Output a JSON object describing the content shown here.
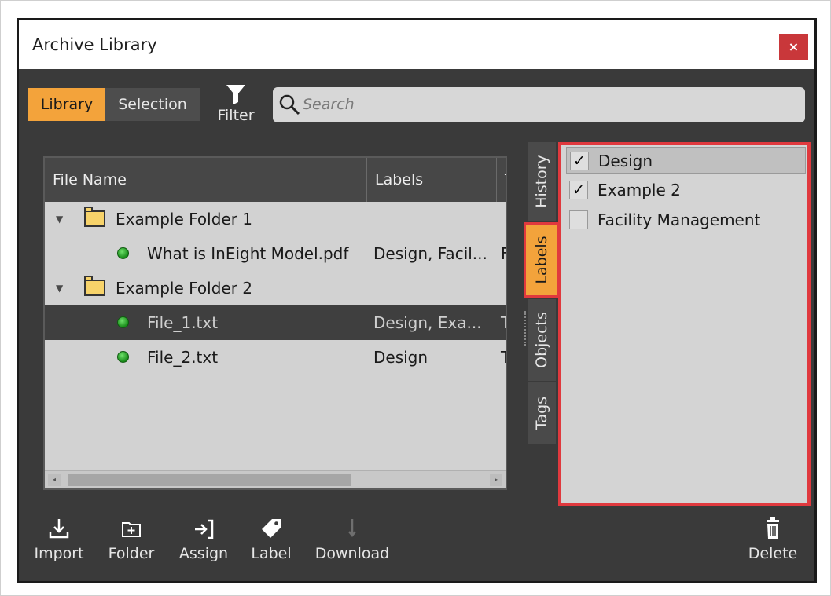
{
  "window": {
    "title": "Archive Library",
    "close_label": "×"
  },
  "top": {
    "tabs": [
      "Library",
      "Selection"
    ],
    "filter_label": "Filter",
    "search_placeholder": "Search"
  },
  "tree": {
    "columns": [
      "File Name",
      "Labels",
      "T"
    ],
    "rows": [
      {
        "type": "folder",
        "name": "Example Folder 1",
        "labels": "",
        "extra": ""
      },
      {
        "type": "file",
        "name": "What is InEight Model.pdf",
        "labels": "Design, Facil...",
        "extra": "F"
      },
      {
        "type": "folder",
        "name": "Example Folder 2",
        "labels": "",
        "extra": ""
      },
      {
        "type": "file",
        "name": "File_1.txt",
        "labels": "Design, Exa...",
        "extra": "T",
        "selected": true
      },
      {
        "type": "file",
        "name": "File_2.txt",
        "labels": "Design",
        "extra": "T"
      }
    ]
  },
  "side_tabs": [
    "History",
    "Labels",
    "Objects",
    "Tags"
  ],
  "labels_panel": {
    "items": [
      {
        "name": "Design",
        "checked": true,
        "check": "✓"
      },
      {
        "name": "Example 2",
        "checked": true,
        "check": "✓"
      },
      {
        "name": "Facility Management",
        "checked": false,
        "check": ""
      }
    ]
  },
  "toolbar": {
    "import": "Import",
    "folder": "Folder",
    "assign": "Assign",
    "label": "Label",
    "download": "Download",
    "delete": "Delete"
  },
  "colors": {
    "accent": "#f3a33b",
    "highlight": "#e0393e",
    "close": "#c9373a"
  }
}
